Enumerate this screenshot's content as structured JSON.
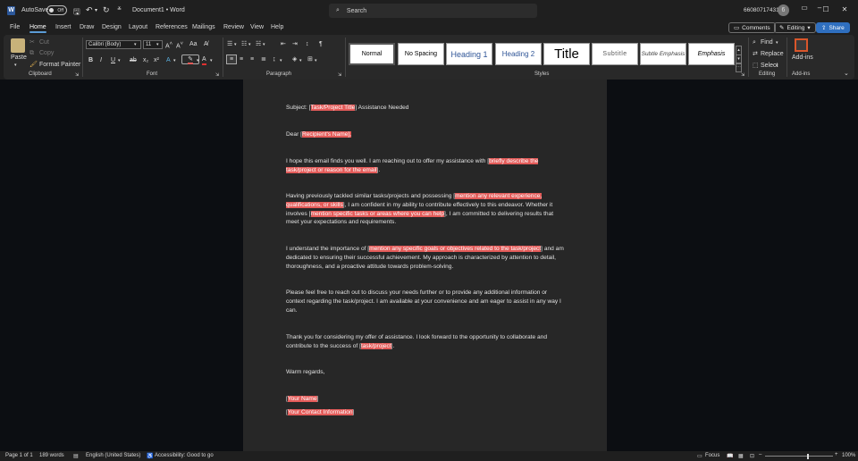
{
  "titlebar": {
    "autosave_label": "AutoSave",
    "autosave_state": "Off",
    "document_title": "Document1 • Word",
    "search_placeholder": "Search",
    "account": "66080717431",
    "avatar_letter": "6"
  },
  "tabs": [
    "File",
    "Home",
    "Insert",
    "Draw",
    "Design",
    "Layout",
    "References",
    "Mailings",
    "Review",
    "View",
    "Help"
  ],
  "active_tab": "Home",
  "topright": {
    "comments": "Comments",
    "editing": "Editing",
    "share": "Share"
  },
  "ribbon": {
    "clipboard": {
      "paste": "Paste",
      "cut": "Cut",
      "copy": "Copy",
      "format_painter": "Format Painter",
      "label": "Clipboard"
    },
    "font": {
      "name": "Calibri (Body)",
      "size": "11",
      "label": "Font"
    },
    "paragraph": {
      "label": "Paragraph"
    },
    "styles": {
      "items": [
        "Normal",
        "No Spacing",
        "Heading 1",
        "Heading 2",
        "Title",
        "Subtitle",
        "Subtle Emphasis",
        "Emphasis"
      ],
      "label": "Styles"
    },
    "editing": {
      "find": "Find",
      "replace": "Replace",
      "select": "Select",
      "label": "Editing"
    },
    "addins": {
      "button": "Add-ins",
      "label": "Add-ins"
    }
  },
  "document": {
    "subject_prefix": "Subject: [",
    "subject_placeholder": "Task/Project Title",
    "subject_suffix": "] Assistance Needed",
    "dear_prefix": "Dear [",
    "dear_placeholder": "Recipient's Name",
    "dear_suffix": "],",
    "p1_text": "I hope this email finds you well. I am reaching out to offer my assistance with [",
    "p1_placeholder": "briefly describe the task/project or reason for the email",
    "p1_end": "].",
    "p2_text1": "Having previously tackled similar tasks/projects and possessing [",
    "p2_placeholder1": "mention any relevant experience, qualifications, or skills",
    "p2_text2": "], I am confident in my ability to contribute effectively to this endeavor. Whether it involves [",
    "p2_placeholder2": "mention specific tasks or areas where you can help",
    "p2_text3": "], I am committed to delivering results that meet your expectations and requirements.",
    "p3_text1": "I understand the importance of [",
    "p3_placeholder": "mention any specific goals or objectives related to the task/project",
    "p3_text2": "] and am dedicated to ensuring their successful achievement. My approach is characterized by attention to detail, thoroughness, and a proactive attitude towards problem-solving.",
    "p4": "Please feel free to reach out to discuss your needs further or to provide any additional information or context regarding the task/project. I am available at your convenience and am eager to assist in any way I can.",
    "p5_text1": "Thank you for considering my offer of assistance. I look forward to the opportunity to collaborate and contribute to the success of [",
    "p5_placeholder": "task/project",
    "p5_end": "].",
    "closing": "Warm regards,",
    "name_placeholder": "Your Name",
    "contact_placeholder": "Your Contact Information",
    "bracket_open": "[",
    "bracket_close": "]"
  },
  "status": {
    "page": "Page 1 of 1",
    "words": "189 words",
    "language": "English (United States)",
    "accessibility": "Accessibility: Good to go",
    "focus": "Focus",
    "zoom": "100%"
  },
  "colors": {
    "highlight": "#e35b59",
    "accent": "#2f6fbf",
    "page": "#272727",
    "background": "#0c0e12"
  }
}
